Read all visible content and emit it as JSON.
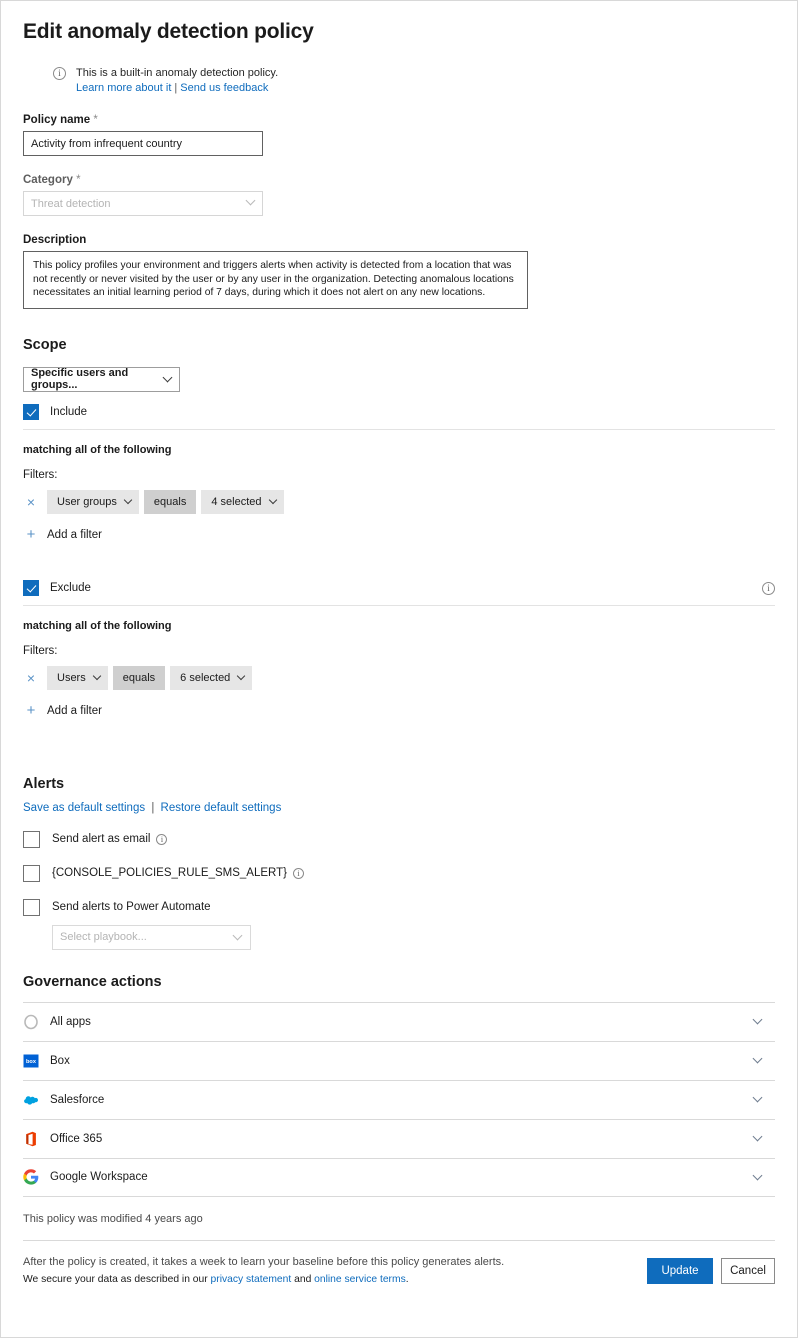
{
  "header": {
    "title": "Edit anomaly detection policy"
  },
  "info_banner": {
    "icon": "info-icon",
    "text": "This is a built-in anomaly detection policy.",
    "learn_more_link": "Learn more about it",
    "separator": "|",
    "feedback_link": "Send us feedback"
  },
  "policy_name": {
    "label": "Policy name",
    "required_mark": "*",
    "value": "Activity from infrequent country",
    "placeholder": "Policy name"
  },
  "category": {
    "label": "Category",
    "required_mark": "*",
    "value": "Threat detection",
    "chevron": "chevron-down-icon"
  },
  "description": {
    "label": "Description",
    "value": "This policy profiles your environment and triggers alerts when activity is detected from a location that was not recently or never visited by the user or by any user in the organization. Detecting anomalous locations necessitates an initial learning period of 7 days, during which it does not alert on any new locations."
  },
  "scope": {
    "title": "Scope",
    "selector_value": "Specific users and groups...",
    "include": {
      "label": "Include",
      "checked": true,
      "matching_text": "matching all of the following",
      "filters_label": "Filters:",
      "filter": {
        "remove_icon": "×",
        "field": "User groups",
        "operator": "equals",
        "value": "4 selected"
      },
      "add_filter_label": "Add a filter",
      "add_filter_icon": "+"
    },
    "exclude": {
      "label": "Exclude",
      "checked": true,
      "info_icon": "info-icon",
      "matching_text": "matching all of the following",
      "filters_label": "Filters:",
      "filter": {
        "remove_icon": "×",
        "field": "Users",
        "operator": "equals",
        "value": "6 selected"
      },
      "add_filter_label": "Add a filter",
      "add_filter_icon": "+"
    }
  },
  "alerts": {
    "title": "Alerts",
    "save_default_link": "Save as default settings",
    "separator": "|",
    "restore_default_link": "Restore default settings",
    "options": [
      {
        "label": "Send alert as email",
        "checked": false,
        "has_info": true
      },
      {
        "label": "{CONSOLE_POLICIES_RULE_SMS_ALERT}",
        "checked": false,
        "has_info": true
      },
      {
        "label": "Send alerts to Power Automate",
        "checked": false,
        "has_info": false
      }
    ],
    "playbook": {
      "placeholder": "Select playbook...",
      "value": "Select playbook..."
    }
  },
  "governance": {
    "title": "Governance actions",
    "rows": [
      {
        "name": "All apps",
        "icon": "all-apps-icon",
        "chevron": "chevron-down-icon"
      },
      {
        "name": "Box",
        "icon": "box-icon",
        "chevron": "chevron-down-icon"
      },
      {
        "name": "Salesforce",
        "icon": "salesforce-icon",
        "chevron": "chevron-down-icon"
      },
      {
        "name": "Office 365",
        "icon": "office365-icon",
        "chevron": "chevron-down-icon"
      },
      {
        "name": "Google Workspace",
        "icon": "google-workspace-icon",
        "chevron": "chevron-down-icon"
      }
    ]
  },
  "footer": {
    "modified_text": "This policy was modified 4 years ago",
    "note_line1": "After the policy is created, it takes a week to learn your baseline before this policy generates alerts.",
    "note_line2_prefix": "We secure your data as described in our ",
    "privacy_link": "privacy statement",
    "note_line2_mid": " and ",
    "terms_link": "online service terms",
    "note_line2_suffix": ".",
    "update_button": "Update",
    "cancel_button": "Cancel"
  },
  "colors": {
    "accent": "#0f6cbd",
    "link": "#0f6cbd",
    "pill_bg": "#e6e6e6",
    "pill_op_bg": "#cfcfcf",
    "text": "#1b1b1b"
  }
}
